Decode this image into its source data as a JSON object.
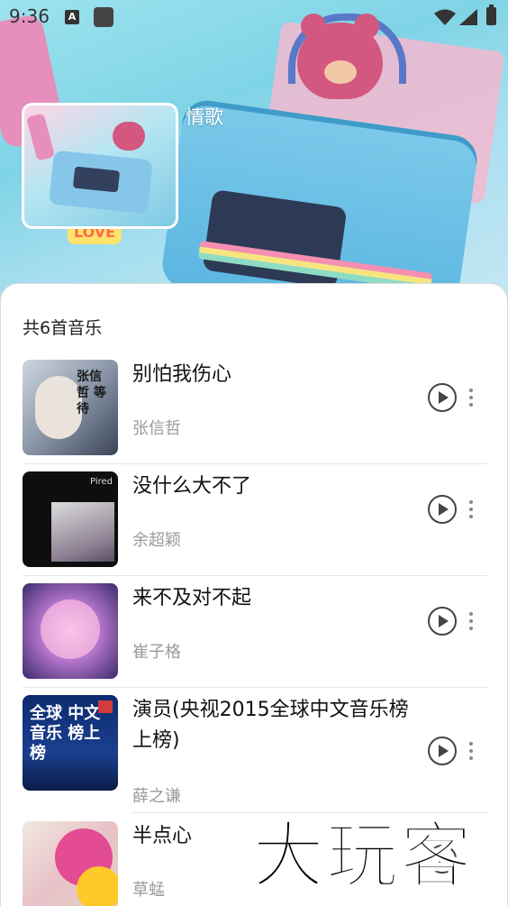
{
  "status_bar": {
    "time": "9:36",
    "notification_icon": "A"
  },
  "playlist": {
    "title": "情歌",
    "song_count_label": "共6首音乐"
  },
  "songs": [
    {
      "title": "别怕我伤心",
      "artist": "张信哲",
      "cover_text": "张信哲 等待"
    },
    {
      "title": "没什么大不了",
      "artist": "余超颖",
      "cover_text": "Pired"
    },
    {
      "title": "来不及对不起",
      "artist": "崔子格",
      "cover_text": ""
    },
    {
      "title": "演员(央视2015全球中文音乐榜上榜)",
      "artist": "薛之谦",
      "cover_text": "全球 中文 音乐 榜上榜"
    },
    {
      "title": "半点心",
      "artist": "草蜢",
      "cover_text": ""
    }
  ],
  "watermark": "大玩客",
  "colors": {
    "hero_accent": "#7fd4e6",
    "play_icon": "#444444",
    "artist_text": "#9a9a9a"
  },
  "icons": {
    "play": "play-circle-icon",
    "more": "more-vertical-icon",
    "wifi": "wifi-icon",
    "signal": "signal-icon",
    "battery": "battery-icon"
  }
}
